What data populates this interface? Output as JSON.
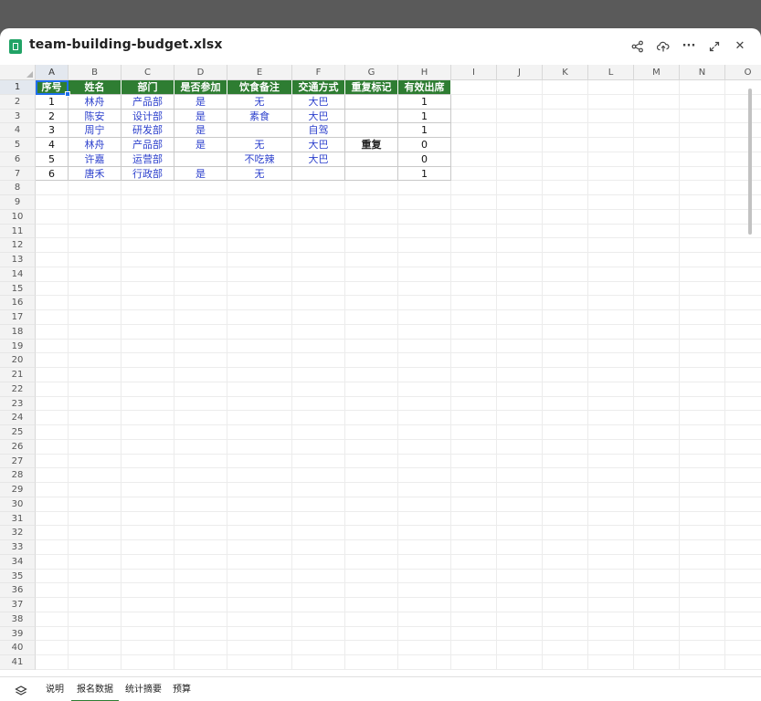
{
  "window": {
    "title": "team-building-budget.xlsx",
    "file_icon": "spreadsheet-icon",
    "toolbar_icons": [
      "share-icon",
      "upload-icon",
      "more-icon",
      "expand-icon",
      "close-icon"
    ],
    "more_label": "···",
    "close_label": "✕"
  },
  "sheet": {
    "columns": [
      "A",
      "B",
      "C",
      "D",
      "E",
      "F",
      "G",
      "H",
      "I",
      "J",
      "K",
      "L",
      "M",
      "N",
      "O"
    ],
    "rows": [
      "1",
      "2",
      "3",
      "4",
      "5",
      "6",
      "7",
      "8",
      "9",
      "10",
      "11",
      "12",
      "13",
      "14",
      "15",
      "16",
      "17",
      "18",
      "19",
      "20",
      "21",
      "22",
      "23",
      "24",
      "25",
      "26",
      "27",
      "28",
      "29",
      "30",
      "31",
      "32",
      "33",
      "34",
      "35",
      "36",
      "37",
      "38",
      "39",
      "40",
      "41"
    ],
    "selected_cell": "A1",
    "header": [
      "序号",
      "姓名",
      "部门",
      "是否参加",
      "饮食备注",
      "交通方式",
      "重复标记",
      "有效出席"
    ],
    "data": [
      [
        "1",
        "林舟",
        "产品部",
        "是",
        "无",
        "大巴",
        "",
        "1"
      ],
      [
        "2",
        "陈安",
        "设计部",
        "是",
        "素食",
        "大巴",
        "",
        "1"
      ],
      [
        "3",
        "周宁",
        "研发部",
        "是",
        "",
        "自驾",
        "",
        "1"
      ],
      [
        "4",
        "林舟",
        "产品部",
        "是",
        "无",
        "大巴",
        "重复",
        "0"
      ],
      [
        "5",
        "许嘉",
        "运营部",
        "",
        "不吃辣",
        "大巴",
        "",
        "0"
      ],
      [
        "6",
        "唐禾",
        "行政部",
        "是",
        "无",
        "",
        "",
        "1"
      ]
    ],
    "header_color": "#2e7d32",
    "text_color_blue": "#2b3fcc"
  },
  "tabs": {
    "items": [
      "说明",
      "报名数据",
      "统计摘要",
      "预算"
    ],
    "active": "报名数据",
    "layers_icon": "layers-icon"
  }
}
